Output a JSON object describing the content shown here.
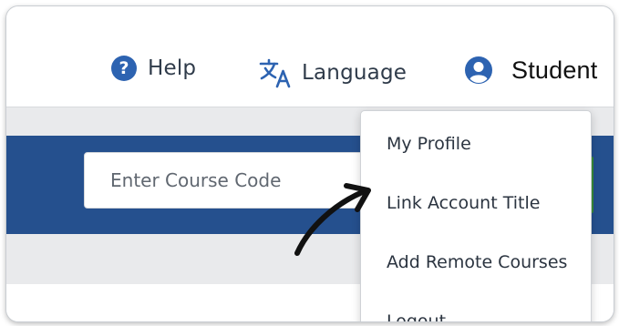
{
  "header": {
    "help_label": "Help",
    "help_icon": "question-circle-icon",
    "language_label": "Language",
    "language_icon": "translate-icon",
    "user_label": "Student",
    "user_icon": "user-circle-icon",
    "accent_color": "#2d63b1"
  },
  "search": {
    "placeholder": "Enter Course Code"
  },
  "banner": {
    "color": "#25508e"
  },
  "user_menu": {
    "items": [
      {
        "label": "My Profile"
      },
      {
        "label": "Link Account Title"
      },
      {
        "label": "Add Remote Courses"
      },
      {
        "label": "Logout"
      }
    ]
  },
  "annotation": {
    "icon": "curved-arrow-icon"
  }
}
